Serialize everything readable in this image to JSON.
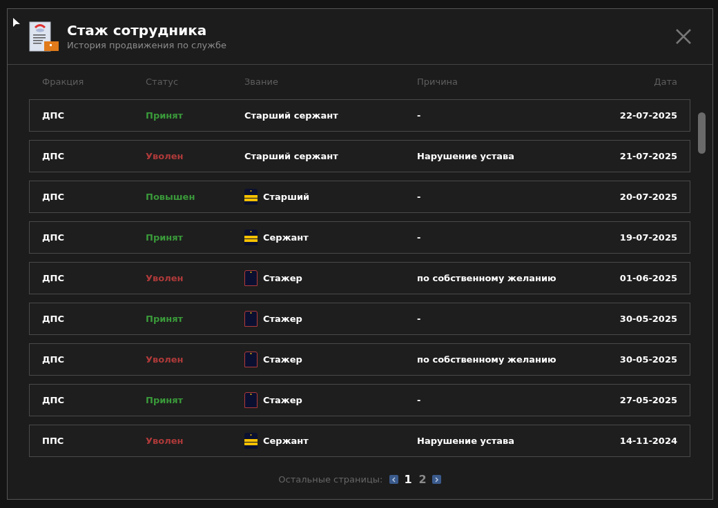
{
  "window": {
    "title": "Стаж сотрудника",
    "subtitle": "История продвижения по службе"
  },
  "table": {
    "columns": [
      "Фракция",
      "Статус",
      "Звание",
      "Причина",
      "Дата"
    ],
    "rows": [
      {
        "faction": "ДПС",
        "status": {
          "text": "Принят",
          "kind": "positive"
        },
        "rank": {
          "text": "Старший сержант"
        },
        "reason": "-",
        "date": "22-07-2025"
      },
      {
        "faction": "ДПС",
        "status": {
          "text": "Уволен",
          "kind": "negative"
        },
        "rank": {
          "text": "Старший сержант"
        },
        "reason": "Нарушение устава",
        "date": "21-07-2025"
      },
      {
        "faction": "ДПС",
        "status": {
          "text": "Повышен",
          "kind": "positive"
        },
        "rank": {
          "text": "Старший",
          "insignia": {
            "kind": "striped"
          }
        },
        "reason": "-",
        "date": "20-07-2025"
      },
      {
        "faction": "ДПС",
        "status": {
          "text": "Принят",
          "kind": "positive"
        },
        "rank": {
          "text": "Сержант",
          "insignia": {
            "kind": "striped"
          }
        },
        "reason": "-",
        "date": "19-07-2025"
      },
      {
        "faction": "ДПС",
        "status": {
          "text": "Уволен",
          "kind": "negative"
        },
        "rank": {
          "text": "Стажер",
          "insignia": {
            "kind": "plain"
          }
        },
        "reason": "по собственному желанию",
        "date": "01-06-2025"
      },
      {
        "faction": "ДПС",
        "status": {
          "text": "Принят",
          "kind": "positive"
        },
        "rank": {
          "text": "Стажер",
          "insignia": {
            "kind": "plain"
          }
        },
        "reason": "-",
        "date": "30-05-2025"
      },
      {
        "faction": "ДПС",
        "status": {
          "text": "Уволен",
          "kind": "negative"
        },
        "rank": {
          "text": "Стажер",
          "insignia": {
            "kind": "plain"
          }
        },
        "reason": "по собственному желанию",
        "date": "30-05-2025"
      },
      {
        "faction": "ДПС",
        "status": {
          "text": "Принят",
          "kind": "positive"
        },
        "rank": {
          "text": "Стажер",
          "insignia": {
            "kind": "plain"
          }
        },
        "reason": "-",
        "date": "27-05-2025"
      },
      {
        "faction": "ППС",
        "status": {
          "text": "Уволен",
          "kind": "negative"
        },
        "rank": {
          "text": "Сержант",
          "insignia": {
            "kind": "striped"
          }
        },
        "reason": "Нарушение устава",
        "date": "14-11-2024"
      }
    ]
  },
  "pagination": {
    "label": "Остальные страницы:",
    "pages": [
      {
        "label": "1",
        "selected": true
      },
      {
        "label": "2",
        "selected": false
      }
    ]
  }
}
